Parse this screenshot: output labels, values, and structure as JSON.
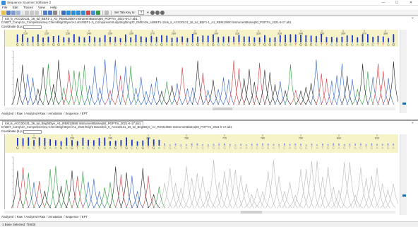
{
  "app": {
    "title": "Sequence Scanner Software 2",
    "window_controls": [
      "—",
      "☐",
      "✕"
    ]
  },
  "menu": [
    "File",
    "Edit",
    "Traces",
    "View",
    "Help"
  ],
  "toolbar": {
    "tab_key_label": "Set Tab Key to:",
    "tab_key_value": "T"
  },
  "panel1": {
    "tab_label": "tok_5_ACG20131_26_tul_BEF1-1_A1_REM13550 InstrumentBaSeq50_POPTm_2021-6-17.ab1",
    "path": "D:\\BDT_Comp\\1A_CompetitiveSeq Chem\\BrightDye4\\A1.ab1\\BEF1-1\\_ComparisonStudy\\Brightmp22_050bnDe_tul\\BEF1-1\\tok_5_ACG20131_26_tul_BEF1-1_A1_REM13550 InstrumentBaSeq50_POPTm_2021-6-17.ab1",
    "coord_label": "Coordinate (b.p.)",
    "bases": "GGCCGGAGGATAAACCCCTCTCACCCCCGAGCTCCGTCGCCCTTGGGTGGGCGATGGGCTTCCCGCAGACTTCG",
    "ticks": [
      "210",
      "220",
      "230",
      "240",
      "250",
      "260",
      "270",
      "280",
      "290",
      "300",
      "310",
      "320",
      "330",
      "340",
      "350",
      "360",
      "370",
      "380"
    ],
    "bottom_tabs": [
      "Analyzed",
      "Raw",
      "Analyzed+Raw",
      "Annotation",
      "Sequence",
      "EPT"
    ]
  },
  "panel2": {
    "tab_label": "tok_5_ACG20131_26_tul_BrightDye_A1_REM13550 InstrumentBaSeq50_POPTm_2021-6-17.ab1",
    "path": "D:\\BDT_Comp\\1A_CompetitiveSeq Chem\\BrightDye4\\A1_2021-Bright Dates\\tok_5_ACG20131_26_tul_BrightDye_A1_REM13550 InstrumentBaSeq50_POPTm_2021-6-17.ab1",
    "coord_label": "Coordinate (b.p.)",
    "bases": "GTACTGAAGAGTACCCAAGTGCCGTGACGCTATACTGCGTGAACCGGATCAGGGTATGGA",
    "ticks": [
      "720",
      "730",
      "740",
      "750",
      "760",
      "770",
      "780",
      "790",
      "800",
      "810"
    ],
    "bottom_tabs": [
      "Analyzed",
      "Raw",
      "Analyzed+Raw",
      "Annotation",
      "Sequence",
      "EPT"
    ]
  },
  "status": {
    "text": "1 Base Selected: T(603)"
  },
  "colors": {
    "A": "#2e9a3f",
    "C": "#2d5fc4",
    "G": "#222222",
    "T": "#d0343a",
    "qv_bar": "#1a35c8",
    "low_quality_trace": "#b9b9b9",
    "highlight": "#f7f3c9"
  }
}
